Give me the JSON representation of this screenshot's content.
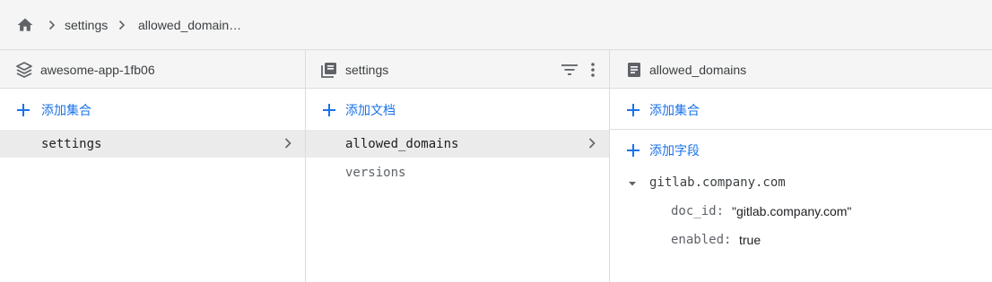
{
  "breadcrumb": {
    "home_icon": "home-icon",
    "items": [
      "settings",
      "allowed_domain…"
    ]
  },
  "columns": [
    {
      "header": {
        "icon": "database-icon",
        "title": "awesome-app-1fb06"
      },
      "add_label": "添加集合",
      "items": [
        {
          "label": "settings",
          "selected": true
        }
      ]
    },
    {
      "header": {
        "icon": "collection-icon",
        "title": "settings",
        "actions": [
          "filter-icon",
          "more-vert-icon"
        ]
      },
      "add_label": "添加文档",
      "items": [
        {
          "label": "allowed_domains",
          "selected": true
        },
        {
          "label": "versions",
          "selected": false
        }
      ]
    },
    {
      "header": {
        "icon": "document-icon",
        "title": "allowed_domains"
      },
      "add_collection_label": "添加集合",
      "add_field_label": "添加字段",
      "map": {
        "key": "gitlab.company.com",
        "expanded": true,
        "fields": [
          {
            "key": "doc_id:",
            "value": "\"gitlab.company.com\""
          },
          {
            "key": "enabled:",
            "value": "true"
          }
        ]
      }
    }
  ],
  "colors": {
    "accent": "#1a73e8",
    "header_bg": "#f5f5f5",
    "selected_bg": "#ebebeb",
    "icon": "#5f6368"
  }
}
